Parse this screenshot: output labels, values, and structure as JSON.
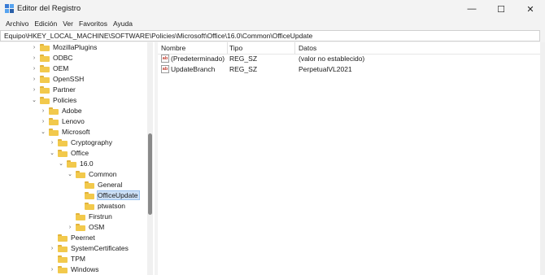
{
  "window": {
    "title": "Editor del Registro",
    "minimize": "—",
    "maximize": "☐",
    "close": "✕"
  },
  "menu": [
    "Archivo",
    "Edición",
    "Ver",
    "Favoritos",
    "Ayuda"
  ],
  "address": "Equipo\\HKEY_LOCAL_MACHINE\\SOFTWARE\\Policies\\Microsoft\\Office\\16.0\\Common\\OfficeUpdate",
  "tree": [
    {
      "label": "MozillaPlugins",
      "expander": "›"
    },
    {
      "label": "ODBC",
      "expander": "›"
    },
    {
      "label": "OEM",
      "expander": "›"
    },
    {
      "label": "OpenSSH",
      "expander": "›"
    },
    {
      "label": "Partner",
      "expander": "›"
    },
    {
      "label": "Policies",
      "expander": "⌄"
    },
    {
      "label": "Adobe",
      "expander": "›"
    },
    {
      "label": "Lenovo",
      "expander": "›"
    },
    {
      "label": "Microsoft",
      "expander": "⌄"
    },
    {
      "label": "Cryptography",
      "expander": "›"
    },
    {
      "label": "Office",
      "expander": "⌄"
    },
    {
      "label": "16.0",
      "expander": "⌄"
    },
    {
      "label": "Common",
      "expander": "⌄"
    },
    {
      "label": "General",
      "expander": ""
    },
    {
      "label": "OfficeUpdate",
      "expander": ""
    },
    {
      "label": "ptwatson",
      "expander": ""
    },
    {
      "label": "Firstrun",
      "expander": ""
    },
    {
      "label": "OSM",
      "expander": "›"
    },
    {
      "label": "Peernet",
      "expander": ""
    },
    {
      "label": "SystemCertificates",
      "expander": "›"
    },
    {
      "label": "TPM",
      "expander": ""
    },
    {
      "label": "Windows",
      "expander": "›"
    }
  ],
  "columns": {
    "name": "Nombre",
    "type": "Tipo",
    "data": "Datos"
  },
  "values": [
    {
      "icon": "ab",
      "name": "(Predeterminado)",
      "type": "REG_SZ",
      "data": "(valor no establecido)"
    },
    {
      "icon": "ab",
      "name": "UpdateBranch",
      "type": "REG_SZ",
      "data": "PerpetualVL2021"
    }
  ]
}
